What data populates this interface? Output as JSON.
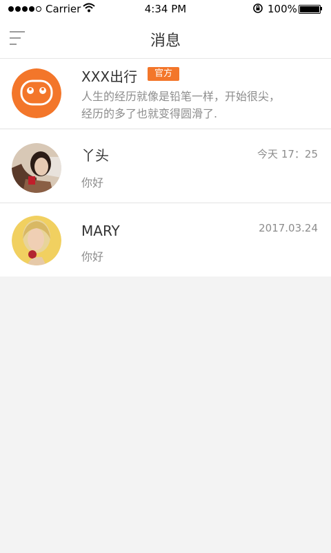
{
  "status_bar": {
    "carrier": "Carrier",
    "time": "4:34 PM",
    "battery": "100%",
    "battery_level": 1.0,
    "icons": [
      "signal-icon",
      "wifi-icon",
      "rotation-lock-icon",
      "battery-icon"
    ]
  },
  "header": {
    "title": "消息",
    "menu_icon": "menu-icon"
  },
  "messages": [
    {
      "name": "XXX出行",
      "badge": "官方",
      "preview_line1": "人生的经历就像是铅笔一样，开始很尖，",
      "preview_line2": "经历的多了也就变得圆滑了.",
      "avatar": "orange-face-icon"
    },
    {
      "name": "丫头",
      "time": "今天 17：25",
      "preview": "你好",
      "avatar": "girl-photo"
    },
    {
      "name": "MARY",
      "time": "2017.03.24",
      "preview": "你好",
      "avatar": "blonde-woman-photo"
    }
  ],
  "colors": {
    "accent": "#f3762a",
    "background": "#f3f3f3",
    "text": "#333333",
    "secondary_text": "#8c8c8c"
  }
}
